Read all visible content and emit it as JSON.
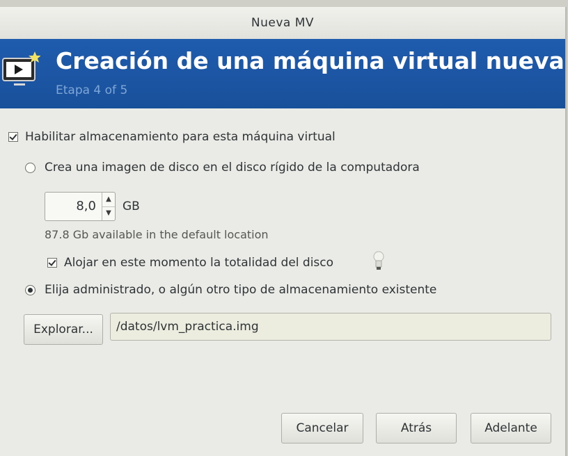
{
  "window": {
    "title": "Nueva MV"
  },
  "banner": {
    "title": "Creación de una máquina virtual nueva",
    "step": "Etapa 4 of 5"
  },
  "storage": {
    "enable_label": "Habilitar almacenamiento para esta máquina virtual",
    "enable_checked": true,
    "create_image_label": "Crea una imagen de disco en el disco rígido de la computadora",
    "create_image_selected": false,
    "size_value": "8,0",
    "size_unit": "GB",
    "available_text": "87.8 Gb available in the default location",
    "allocate_label": "Alojar en este momento la totalidad del disco",
    "allocate_checked": true,
    "existing_label": "Elija administrado, o algún otro tipo de almacenamiento existente",
    "existing_selected": true,
    "browse_label": "Explorar...",
    "path_value": "/datos/lvm_practica.img"
  },
  "buttons": {
    "cancel": "Cancelar",
    "back": "Atrás",
    "forward": "Adelante"
  },
  "icons": {
    "banner": "vm-new-icon",
    "hint": "lightbulb-icon"
  },
  "colors": {
    "banner_bg": "#1c58a8",
    "banner_step": "#7fa7d6"
  }
}
